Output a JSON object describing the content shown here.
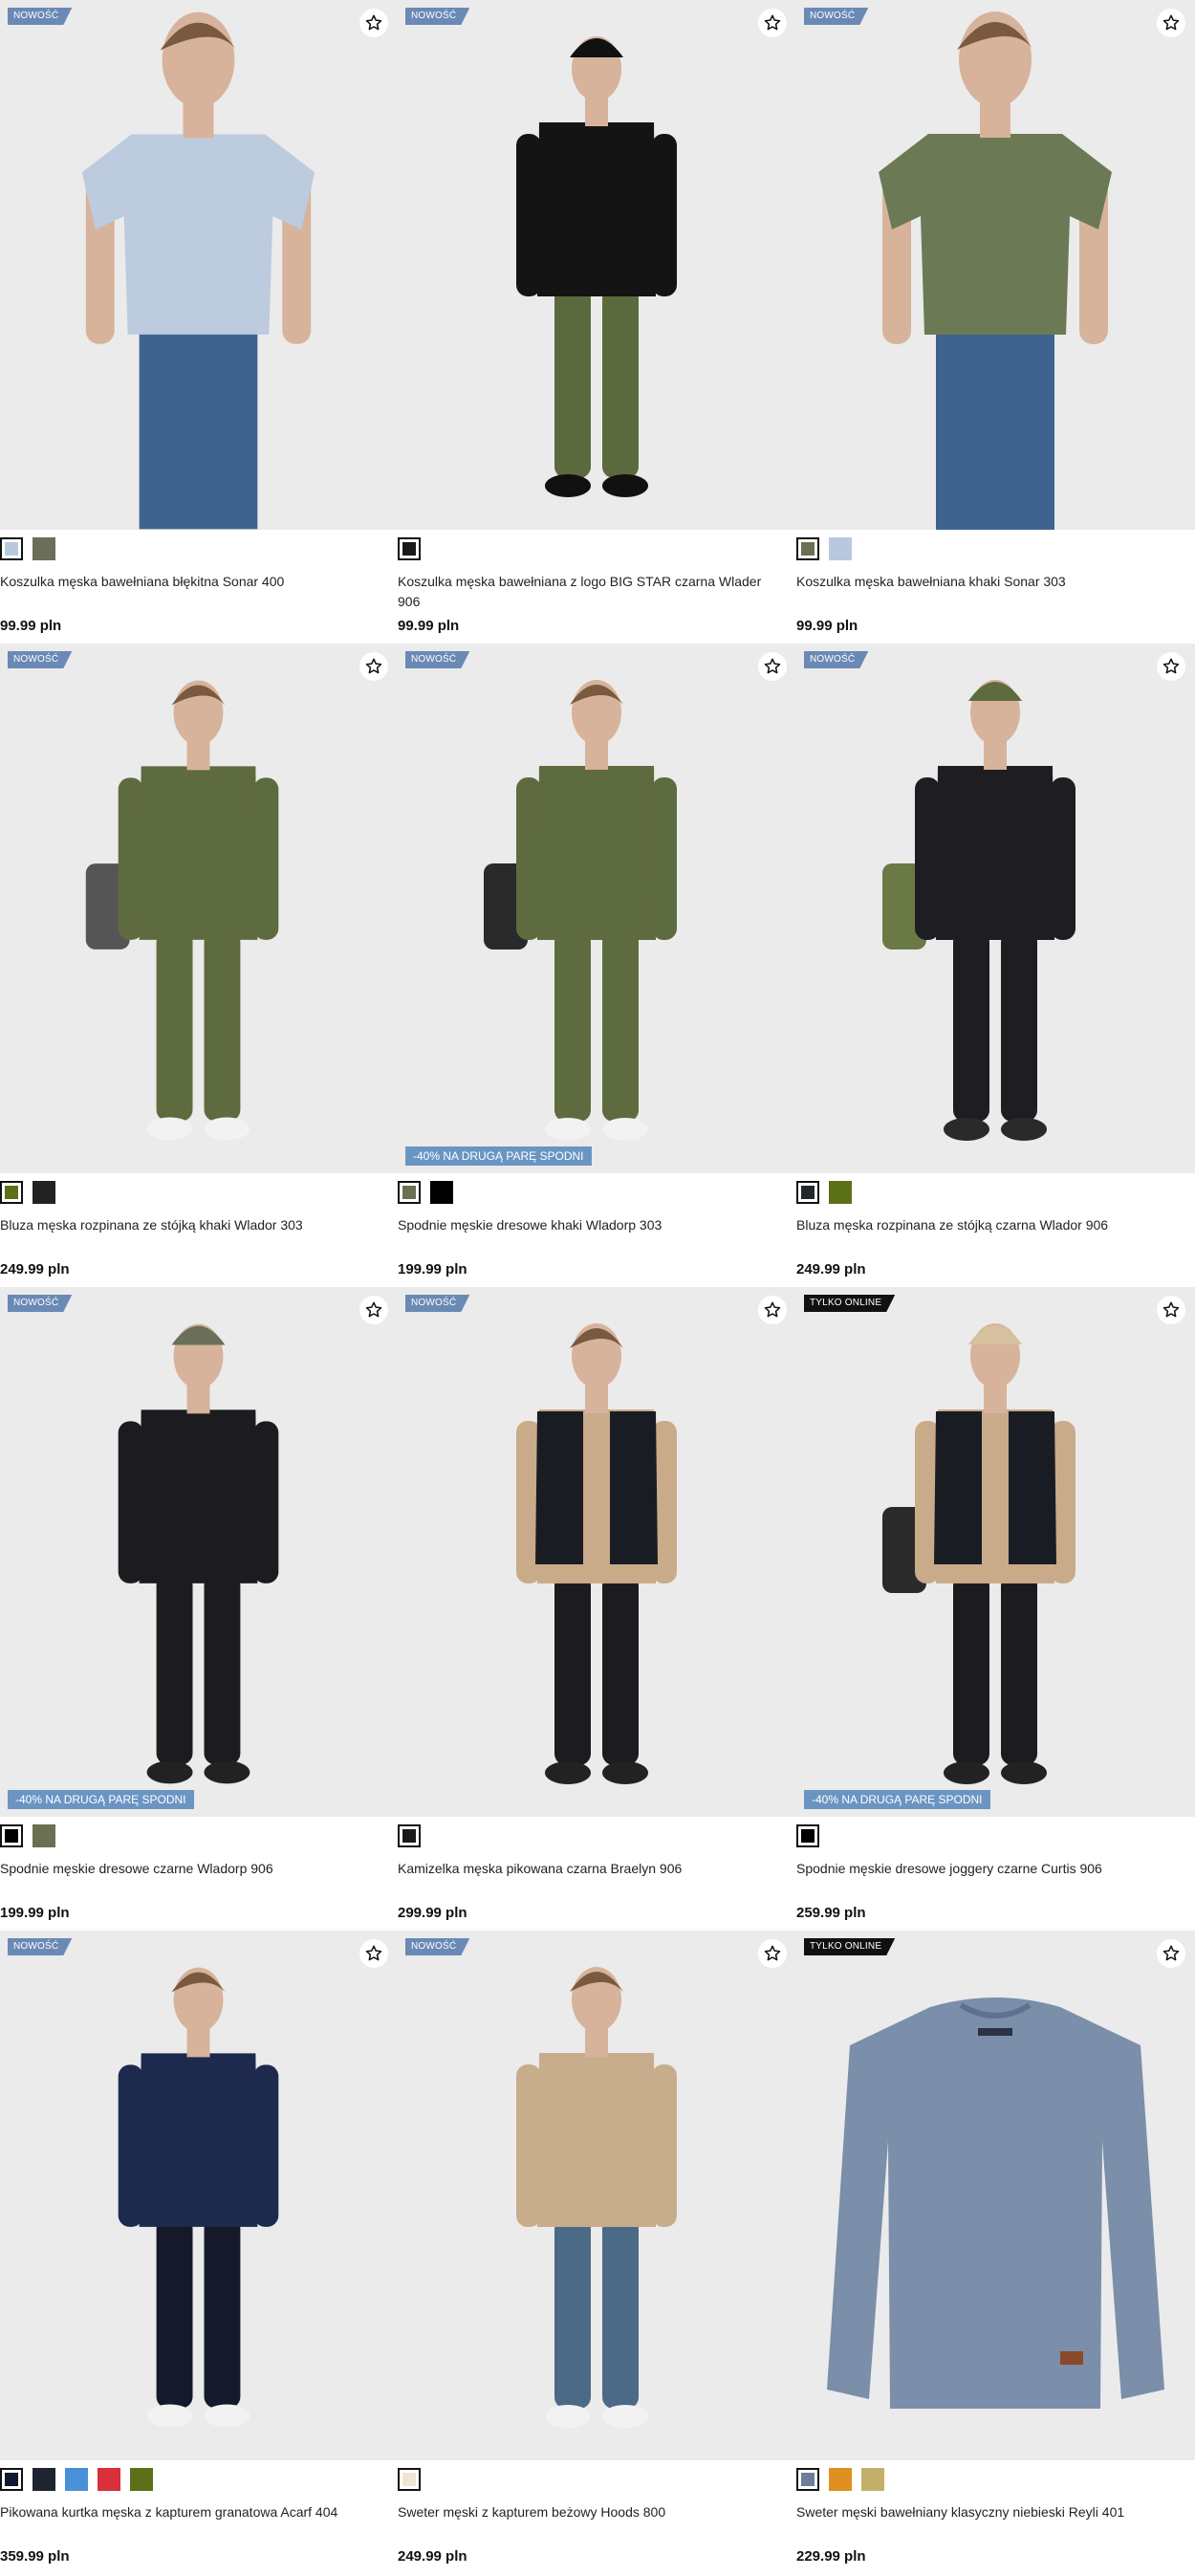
{
  "products": [
    {
      "badge": "NOWOŚĆ",
      "badge_type": "new",
      "promo": "",
      "name": "Koszulka męska bawełniana błękitna Sonar 400",
      "price": "99.99 pln",
      "swatches": [
        "#b8c9dd",
        "#6b6e58"
      ],
      "figure": {
        "top": "#bccbdd",
        "bottom": "#3f628e",
        "skin": "#d7b39b",
        "hair": "#7a5a3e",
        "cap": "",
        "shoes": "",
        "bag": "",
        "kind": "tee"
      }
    },
    {
      "badge": "NOWOŚĆ",
      "badge_type": "new",
      "promo": "",
      "name": "Koszulka męska bawełniana z logo BIG STAR czarna Wlader 906",
      "price": "99.99 pln",
      "swatches": [
        "#1a1a1a"
      ],
      "figure": {
        "top": "#141414",
        "bottom": "#5a6a3d",
        "skin": "#d7b39b",
        "hair": "#6a4f36",
        "cap": "#111111",
        "shoes": "#111111",
        "bag": "",
        "kind": "full"
      }
    },
    {
      "badge": "NOWOŚĆ",
      "badge_type": "new",
      "promo": "",
      "name": "Koszulka męska bawełniana khaki Sonar 303",
      "price": "99.99 pln",
      "swatches": [
        "#6a7052",
        "#b8c9dd"
      ],
      "figure": {
        "top": "#6b7a55",
        "bottom": "#3f628e",
        "skin": "#d7b39b",
        "hair": "#7a5a3e",
        "cap": "",
        "shoes": "",
        "bag": "",
        "kind": "tee"
      }
    },
    {
      "badge": "NOWOŚĆ",
      "badge_type": "new",
      "promo": "",
      "name": "Bluza męska rozpinana ze stójką khaki Wlador 303",
      "price": "249.99 pln",
      "swatches": [
        "#5c7018",
        "#222222"
      ],
      "figure": {
        "top": "#5e6b3e",
        "bottom": "#5e6b3e",
        "skin": "#d7b39b",
        "hair": "#7a5a3e",
        "cap": "",
        "shoes": "#f2f2f2",
        "bag": "#555555",
        "kind": "full"
      }
    },
    {
      "badge": "NOWOŚĆ",
      "badge_type": "new",
      "promo": "-40% NA DRUGĄ PARĘ SPODNI",
      "name": "Spodnie męskie dresowe khaki Wladorp 303",
      "price": "199.99 pln",
      "swatches": [
        "#6a7052",
        "#000000"
      ],
      "figure": {
        "top": "#5e6b3e",
        "bottom": "#5e6b3e",
        "skin": "#d7b39b",
        "hair": "#7a5a3e",
        "cap": "",
        "shoes": "#f2f2f2",
        "bag": "#2a2a2a",
        "kind": "full"
      }
    },
    {
      "badge": "NOWOŚĆ",
      "badge_type": "new",
      "promo": "",
      "name": "Bluza męska rozpinana ze stójką czarna Wlador 906",
      "price": "249.99 pln",
      "swatches": [
        "#24262e",
        "#5c7018"
      ],
      "figure": {
        "top": "#1e1e22",
        "bottom": "#1e1e22",
        "skin": "#d7b39b",
        "hair": "#7a5a3e",
        "cap": "#5e6b3e",
        "shoes": "#2a2a2a",
        "bag": "#6b7a45",
        "kind": "full"
      }
    },
    {
      "badge": "NOWOŚĆ",
      "badge_type": "new",
      "promo": "-40% NA DRUGĄ PARĘ SPODNI",
      "name": "Spodnie męskie dresowe czarne Wladorp 906",
      "price": "199.99 pln",
      "swatches": [
        "#000000",
        "#6a7052"
      ],
      "figure": {
        "top": "#1c1c20",
        "bottom": "#1c1c20",
        "skin": "#d7b39b",
        "hair": "#7a5a3e",
        "cap": "#6b6e58",
        "shoes": "#222222",
        "bag": "",
        "kind": "full"
      }
    },
    {
      "badge": "NOWOŚĆ",
      "badge_type": "new",
      "promo": "",
      "name": "Kamizelka męska pikowana czarna Braelyn 906",
      "price": "299.99 pln",
      "swatches": [
        "#1a1a1a"
      ],
      "figure": {
        "top": "#c9ab8a",
        "bottom": "#1c1c20",
        "skin": "#d7b39b",
        "hair": "#7a5a3e",
        "cap": "",
        "shoes": "#222222",
        "bag": "",
        "kind": "vest"
      }
    },
    {
      "badge": "TYLKO ONLINE",
      "badge_type": "online",
      "promo": "-40% NA DRUGĄ PARĘ SPODNI",
      "name": "Spodnie męskie dresowe joggery czarne Curtis 906",
      "price": "259.99 pln",
      "swatches": [
        "#000000"
      ],
      "figure": {
        "top": "#c9ab8a",
        "bottom": "#1c1c20",
        "skin": "#d7b39b",
        "hair": "#7a5a3e",
        "cap": "#d6c09e",
        "shoes": "#222222",
        "bag": "#2a2a2a",
        "kind": "vest"
      }
    },
    {
      "badge": "NOWOŚĆ",
      "badge_type": "new",
      "promo": "",
      "name": "Pikowana kurtka męska z kapturem granatowa Acarf 404",
      "price": "359.99 pln",
      "swatches": [
        "#101a33",
        "#1e2430",
        "#4a90d9",
        "#d9303a",
        "#5c7018"
      ],
      "figure": {
        "top": "#1d2a4d",
        "bottom": "#141a2a",
        "skin": "#d7b39b",
        "hair": "#7a5a3e",
        "cap": "",
        "shoes": "#f2f2f2",
        "bag": "",
        "kind": "full"
      }
    },
    {
      "badge": "NOWOŚĆ",
      "badge_type": "new",
      "promo": "",
      "name": "Sweter męski z kapturem beżowy Hoods 800",
      "price": "249.99 pln",
      "swatches": [
        "#f1e4d3"
      ],
      "figure": {
        "top": "#c8ad8c",
        "bottom": "#4b6a86",
        "skin": "#d7b39b",
        "hair": "#7a5a3e",
        "cap": "",
        "shoes": "#f2f2f2",
        "bag": "",
        "kind": "full"
      }
    },
    {
      "badge": "TYLKO ONLINE",
      "badge_type": "online",
      "promo": "",
      "name": "Sweter męski bawełniany klasyczny niebieski Reyli 401",
      "price": "229.99 pln",
      "swatches": [
        "#6e7e98",
        "#e09020",
        "#c2b06a"
      ],
      "figure": {
        "top": "#7b8eaa",
        "bottom": "",
        "skin": "",
        "hair": "",
        "cap": "",
        "shoes": "",
        "bag": "",
        "kind": "flat"
      }
    }
  ]
}
